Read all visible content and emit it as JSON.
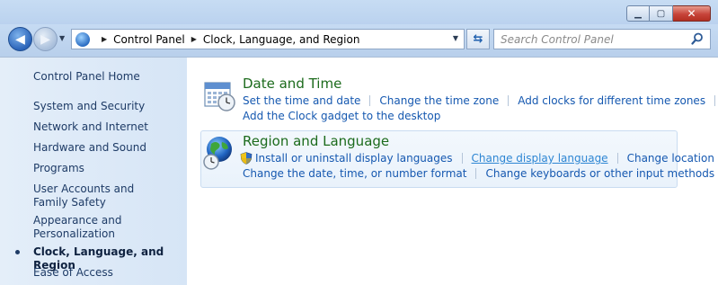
{
  "navigation": {
    "breadcrumb": [
      "Control Panel",
      "Clock, Language, and Region"
    ],
    "search_placeholder": "Search Control Panel"
  },
  "sidebar": {
    "items": [
      {
        "label": "Control Panel Home",
        "active": false
      },
      {
        "label": "System and Security",
        "active": false
      },
      {
        "label": "Network and Internet",
        "active": false
      },
      {
        "label": "Hardware and Sound",
        "active": false
      },
      {
        "label": "Programs",
        "active": false
      },
      {
        "label": "User Accounts and Family Safety",
        "active": false
      },
      {
        "label": "Appearance and Personalization",
        "active": false
      },
      {
        "label": "Clock, Language, and Region",
        "active": true
      },
      {
        "label": "Ease of Access",
        "active": false
      }
    ]
  },
  "categories": [
    {
      "title": "Date and Time",
      "icon": "calendar-clock-icon",
      "links": [
        "Set the time and date",
        "Change the time zone",
        "Add clocks for different time zones",
        "Add the Clock gadget to the desktop"
      ]
    },
    {
      "title": "Region and Language",
      "icon": "globe-clock-icon",
      "links": [
        "Install or uninstall display languages",
        "Change display language",
        "Change location",
        "Change the date, time, or number format",
        "Change keyboards or other input methods"
      ]
    }
  ],
  "colors": {
    "category_title": "#1c6b1c",
    "link": "#1558b0",
    "link_hover": "#2d86d3",
    "sidebar_bg": "#dce9f7"
  }
}
